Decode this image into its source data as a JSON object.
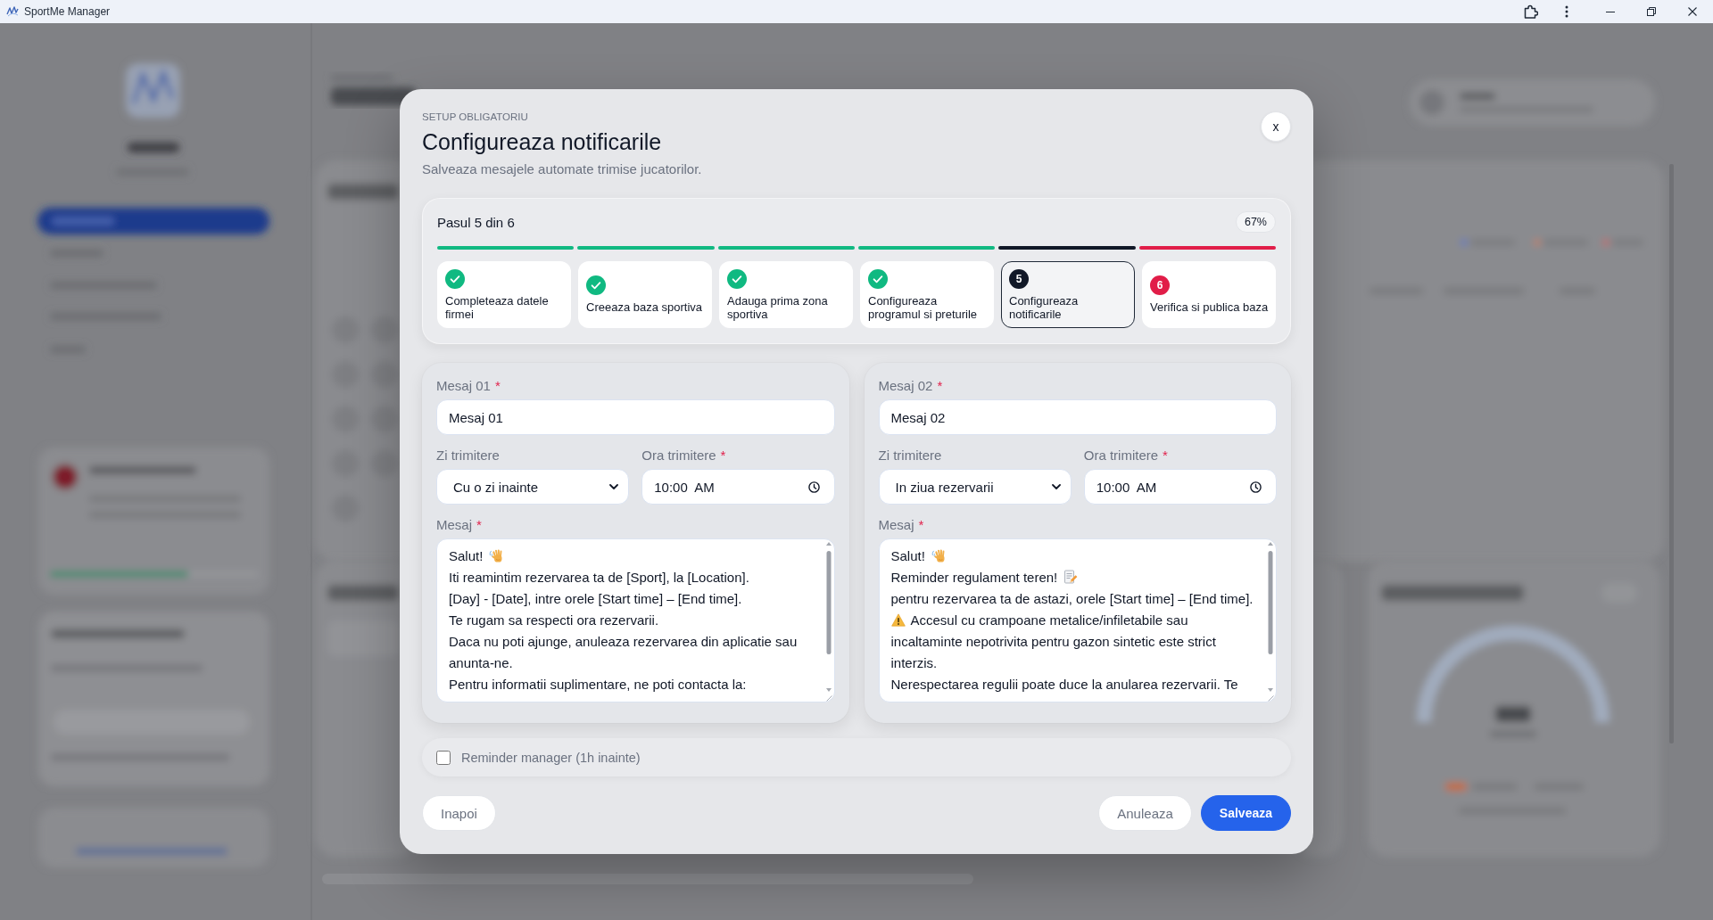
{
  "window": {
    "title": "SportMe Manager"
  },
  "dialog": {
    "eyebrow": "SETUP OBLIGATORIU",
    "title": "Configureaza notificarile",
    "subtitle": "Salveaza mesajele automate trimise jucatorilor.",
    "close": "x"
  },
  "progress": {
    "label": "Pasul 5 din 6",
    "percent": "67%",
    "steps": [
      {
        "label": "Completeaza datele firmei",
        "completed": true,
        "active": false
      },
      {
        "label": "Creeaza baza sportiva",
        "completed": true,
        "active": false
      },
      {
        "label": "Adauga prima zona sportiva",
        "completed": true,
        "active": false
      },
      {
        "label": "Configureaza programul si preturile",
        "completed": true,
        "active": false
      },
      {
        "number": "5",
        "label": "Configureaza notificarile",
        "completed": false,
        "active": true
      },
      {
        "number": "6",
        "label": "Verifica si publica baza",
        "completed": false,
        "active": false
      }
    ]
  },
  "messages": [
    {
      "name_label": {
        "text": "Mesaj 01",
        "required_mark": "*"
      },
      "name_value": "Mesaj 01",
      "day_label": {
        "text": "Zi trimitere"
      },
      "day_value": "Cu o zi inainte",
      "time_label": {
        "text": "Ora trimitere",
        "required_mark": "*"
      },
      "time_value": "10:00 AM",
      "body_label": {
        "text": "Mesaj",
        "required_mark": "*"
      },
      "body_lines": [
        {
          "kind": "greeting",
          "text": "Salut!"
        },
        {
          "kind": "plain",
          "text": "Iti reamintim rezervarea ta de [Sport], la [Location]."
        },
        {
          "kind": "plain",
          "text": "[Day] - [Date], intre orele [Start time] – [End time]."
        },
        {
          "kind": "plain",
          "text": "Te rugam sa respecti ora rezervarii."
        },
        {
          "kind": "plain",
          "text": "Daca nu poti ajunge, anuleaza rezervarea din aplicatie sau anunta-ne."
        },
        {
          "kind": "plain",
          "text": "Pentru informatii suplimentare, ne poti contacta la:"
        }
      ]
    },
    {
      "name_label": {
        "text": "Mesaj 02",
        "required_mark": "*"
      },
      "name_value": "Mesaj 02",
      "day_label": {
        "text": "Zi trimitere"
      },
      "day_value": "In ziua rezervarii",
      "time_label": {
        "text": "Ora trimitere",
        "required_mark": "*"
      },
      "time_value": "10:00 AM",
      "body_label": {
        "text": "Mesaj",
        "required_mark": "*"
      },
      "body_lines": [
        {
          "kind": "greeting",
          "text": "Salut!"
        },
        {
          "kind": "notice",
          "text": "Reminder regulament teren!"
        },
        {
          "kind": "plain",
          "text": "pentru rezervarea ta de astazi, orele [Start time] – [End time]."
        },
        {
          "kind": "warning",
          "text": "Accesul cu crampoane metalice/infiletabile sau incaltaminte nepotrivita pentru gazon sintetic este strict interzis."
        },
        {
          "kind": "plain",
          "text": "Nerespectarea regulii poate duce la anularea rezervarii. Te"
        }
      ]
    }
  ],
  "reminder": {
    "label": "Reminder manager (1h inainte)",
    "checked": false
  },
  "buttons": {
    "back": "Inapoi",
    "cancel": "Anuleaza",
    "save": "Salveaza"
  }
}
